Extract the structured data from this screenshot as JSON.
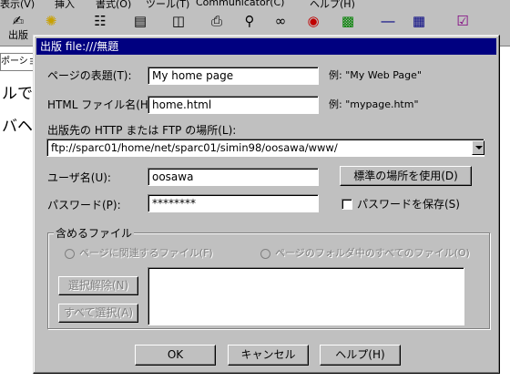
{
  "app": {
    "menu": [
      "表示(V)",
      "挿入",
      "書式(O)",
      "ツール(T)",
      "Communicator(C)",
      "ヘルプ(H)"
    ],
    "toolbar": [
      {
        "label": "出版",
        "icon": "publish-icon"
      },
      {
        "label": "",
        "icon": "new-icon"
      },
      {
        "label": "",
        "icon": "open-icon"
      },
      {
        "label": "",
        "icon": "save-icon"
      },
      {
        "label": "",
        "icon": "paste-icon"
      },
      {
        "label": "",
        "icon": "print-icon"
      },
      {
        "label": "",
        "icon": "find-icon"
      },
      {
        "label": "",
        "icon": "link-icon"
      },
      {
        "label": "",
        "icon": "target-icon"
      },
      {
        "label": "",
        "icon": "image-icon"
      },
      {
        "label": "",
        "icon": "hline-icon"
      },
      {
        "label": "",
        "icon": "table-icon"
      },
      {
        "label": "",
        "icon": "spellcheck-icon"
      }
    ],
    "address_fragment": "ポーション",
    "doc_text_1": "ルで",
    "doc_text_2": "バヘ"
  },
  "dialog": {
    "title": "出版 file:///無題",
    "page_title_label": "ページの表題(T):",
    "page_title_value": "My home page",
    "page_title_example": "例: \"My Web Page\"",
    "filename_label": "HTML ファイル名(H):",
    "filename_value": "home.html",
    "filename_example": "例: \"mypage.htm\"",
    "location_label": "出版先の HTTP または FTP の場所(L):",
    "location_value": "ftp://sparc01/home/net/sparc01/simin98/oosawa/www/",
    "username_label": "ユーザ名(U):",
    "username_value": "oosawa",
    "default_location_button": "標準の場所を使用(D)",
    "password_label": "パスワード(P):",
    "password_value": "********",
    "save_password_label": "パスワードを保存(S)",
    "include_group_label": "含めるファイル",
    "radio_page_files": "ページに関連するファイル(F)",
    "radio_folder_files": "ページのフォルダ中のすべてのファイル(O)",
    "deselect_button": "選択解除(N)",
    "select_all_button": "すべて選択(A)",
    "ok_button": "OK",
    "cancel_button": "キャンセル",
    "help_button": "ヘルプ(H)"
  }
}
